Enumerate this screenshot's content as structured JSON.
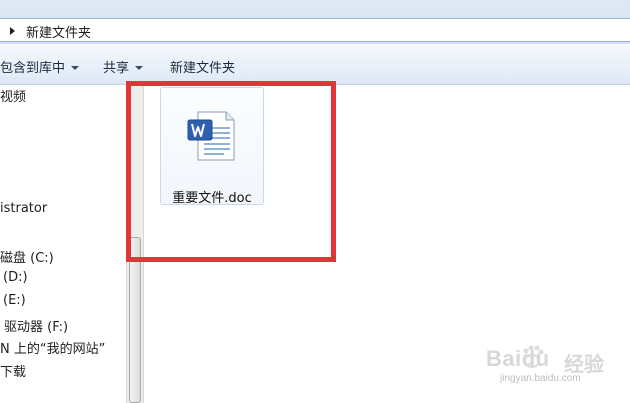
{
  "address": {
    "path": "新建文件夹"
  },
  "toolbar": {
    "include_library": "包含到库中",
    "share": "共享",
    "new_folder": "新建文件夹"
  },
  "nav": {
    "items": [
      {
        "label": "视频"
      },
      {
        "label": "istrator"
      },
      {
        "label": "磁盘 (C:)"
      },
      {
        "label": "(D:)"
      },
      {
        "label": "(E:)"
      },
      {
        "label": "驱动器 (F:)"
      },
      {
        "label": "N 上的“我的网站”"
      },
      {
        "label": "下载"
      }
    ]
  },
  "files": [
    {
      "name": "重要文件.doc",
      "icon": "word-document-icon"
    }
  ],
  "highlight": {
    "color": "#e8323a"
  },
  "watermark": {
    "brand": "Baidu",
    "product": "经验",
    "url": "jingyan.baidu.com"
  }
}
